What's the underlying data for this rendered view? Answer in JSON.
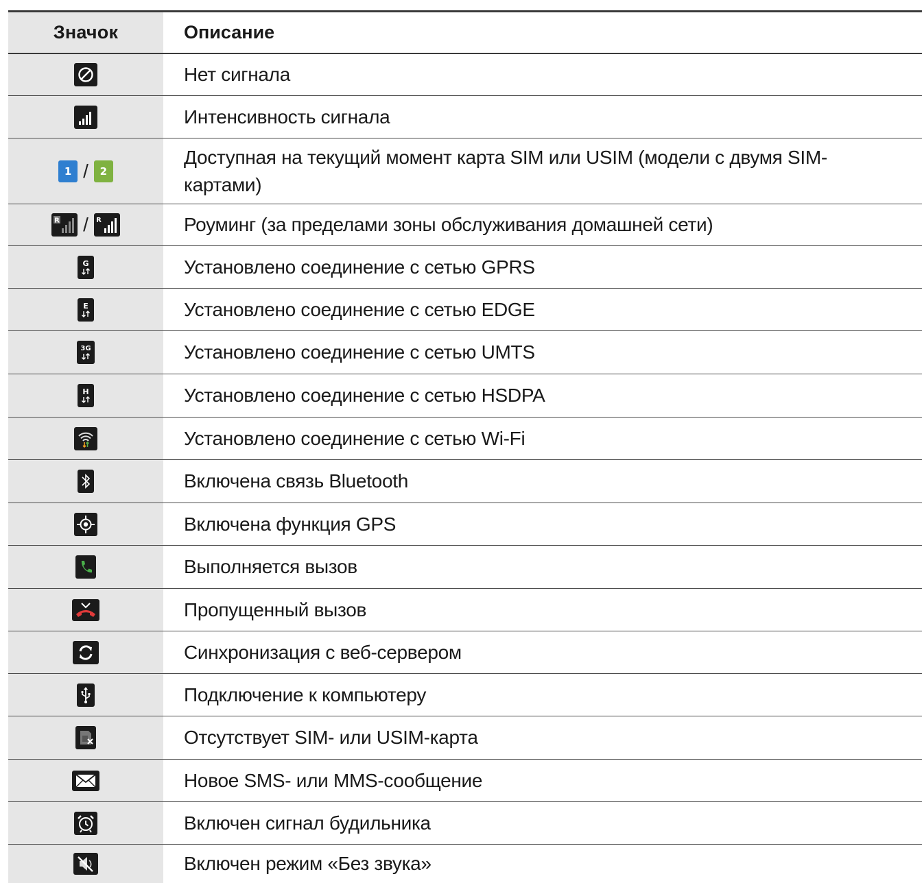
{
  "header": {
    "icon_col": "Значок",
    "desc_col": "Описание"
  },
  "rows": [
    {
      "icon": "no-signal-icon",
      "desc": "Нет сигнала"
    },
    {
      "icon": "signal-strength-icon",
      "desc": "Интенсивность сигнала"
    },
    {
      "icon": "sim-slot-icons",
      "icon_label_1": "1",
      "icon_label_2": "2",
      "separator": "/",
      "desc": "Доступная на текущий момент карта SIM или USIM (модели с двумя SIM-картами)"
    },
    {
      "icon": "roaming-icons",
      "separator": "/",
      "icon_letter": "R",
      "desc": "Роуминг (за пределами зоны обслуживания домашней сети)"
    },
    {
      "icon": "gprs-icon",
      "icon_label": "G",
      "desc": "Установлено соединение с сетью GPRS"
    },
    {
      "icon": "edge-icon",
      "icon_label": "E",
      "desc": "Установлено соединение с сетью EDGE"
    },
    {
      "icon": "umts-icon",
      "icon_label": "3G",
      "desc": "Установлено соединение с сетью UMTS"
    },
    {
      "icon": "hsdpa-icon",
      "icon_label": "H",
      "desc": "Установлено соединение с сетью HSDPA"
    },
    {
      "icon": "wifi-icon",
      "desc": "Установлено соединение с сетью Wi-Fi"
    },
    {
      "icon": "bluetooth-icon",
      "desc": "Включена связь Bluetooth"
    },
    {
      "icon": "gps-icon",
      "desc": "Включена функция GPS"
    },
    {
      "icon": "call-icon",
      "desc": "Выполняется вызов"
    },
    {
      "icon": "missed-call-icon",
      "desc": "Пропущенный вызов"
    },
    {
      "icon": "sync-icon",
      "desc": "Синхронизация с веб-сервером"
    },
    {
      "icon": "usb-icon",
      "desc": "Подключение к компьютеру"
    },
    {
      "icon": "no-sim-icon",
      "desc": "Отсутствует SIM- или USIM-карта"
    },
    {
      "icon": "message-icon",
      "desc": "Новое SMS- или MMS-сообщение"
    },
    {
      "icon": "alarm-icon",
      "desc": "Включен сигнал будильника"
    },
    {
      "icon": "silent-mode-icon",
      "desc": "Включен режим «Без звука»"
    }
  ],
  "colors": {
    "icon_bg": "#1b1b1b",
    "sim1": "#2f7fd0",
    "sim2": "#7fb241",
    "call_green": "#4ab04a",
    "missed_red": "#e03a3a",
    "header_bg": "#e6e6e6"
  }
}
